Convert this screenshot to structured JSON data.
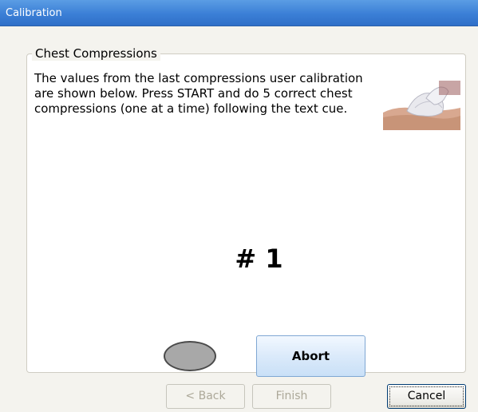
{
  "window": {
    "title": "Calibration"
  },
  "group": {
    "legend": "Chest Compressions",
    "instructions": "The values from the last compressions user calibration are shown below.  Press START and do 5 correct chest compressions (one at a time) following the text cue."
  },
  "counter": {
    "text": "# 1"
  },
  "buttons": {
    "abort": "Abort",
    "back": "< Back",
    "finish": "Finish",
    "cancel": "Cancel"
  },
  "colors": {
    "titlebar": "#3b7fd6",
    "indicator": "#a8a8a8",
    "abort_button": "#dbeafa"
  },
  "icons": {
    "photo": "cpr-hands-photo"
  }
}
